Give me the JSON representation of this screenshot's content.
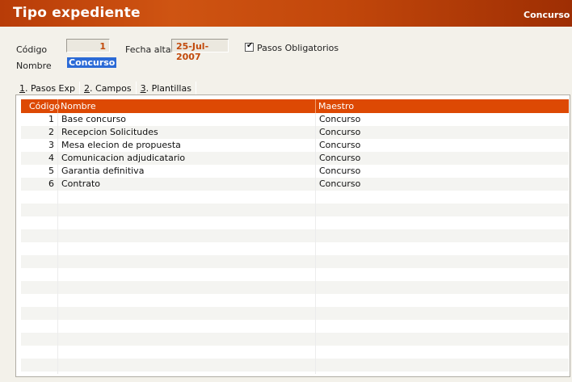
{
  "window": {
    "title": "Tipo expediente",
    "right_label": "Concurso"
  },
  "form": {
    "codigo_label": "Código",
    "codigo_value": "1",
    "fecha_label": "Fecha alta",
    "fecha_value": "25-Jul-2007",
    "pasos_label": "Pasos Obligatorios",
    "pasos_checked": true,
    "nombre_label": "Nombre",
    "nombre_value": "Concurso"
  },
  "tabs": [
    {
      "prefix": "1",
      "label": ". Pasos Exp"
    },
    {
      "prefix": "2",
      "label": ". Campos"
    },
    {
      "prefix": "3",
      "label": ". Plantillas"
    }
  ],
  "grid": {
    "columns": [
      "Código",
      "Nombre",
      "Maestro"
    ],
    "rows": [
      {
        "codigo": "1",
        "nombre": "Base concurso",
        "maestro": "Concurso"
      },
      {
        "codigo": "2",
        "nombre": "Recepcion Solicitudes",
        "maestro": "Concurso"
      },
      {
        "codigo": "3",
        "nombre": "Mesa elecion de propuesta",
        "maestro": "Concurso"
      },
      {
        "codigo": "4",
        "nombre": "Comunicacion adjudicatario",
        "maestro": "Concurso"
      },
      {
        "codigo": "5",
        "nombre": "Garantia definitiva",
        "maestro": "Concurso"
      },
      {
        "codigo": "6",
        "nombre": "Contrato",
        "maestro": "Concurso"
      }
    ]
  },
  "colors": {
    "accent": "#dd4904",
    "title_bar": "#c2470b",
    "value_text": "#c24a0c",
    "selection": "#2b6ad6"
  }
}
